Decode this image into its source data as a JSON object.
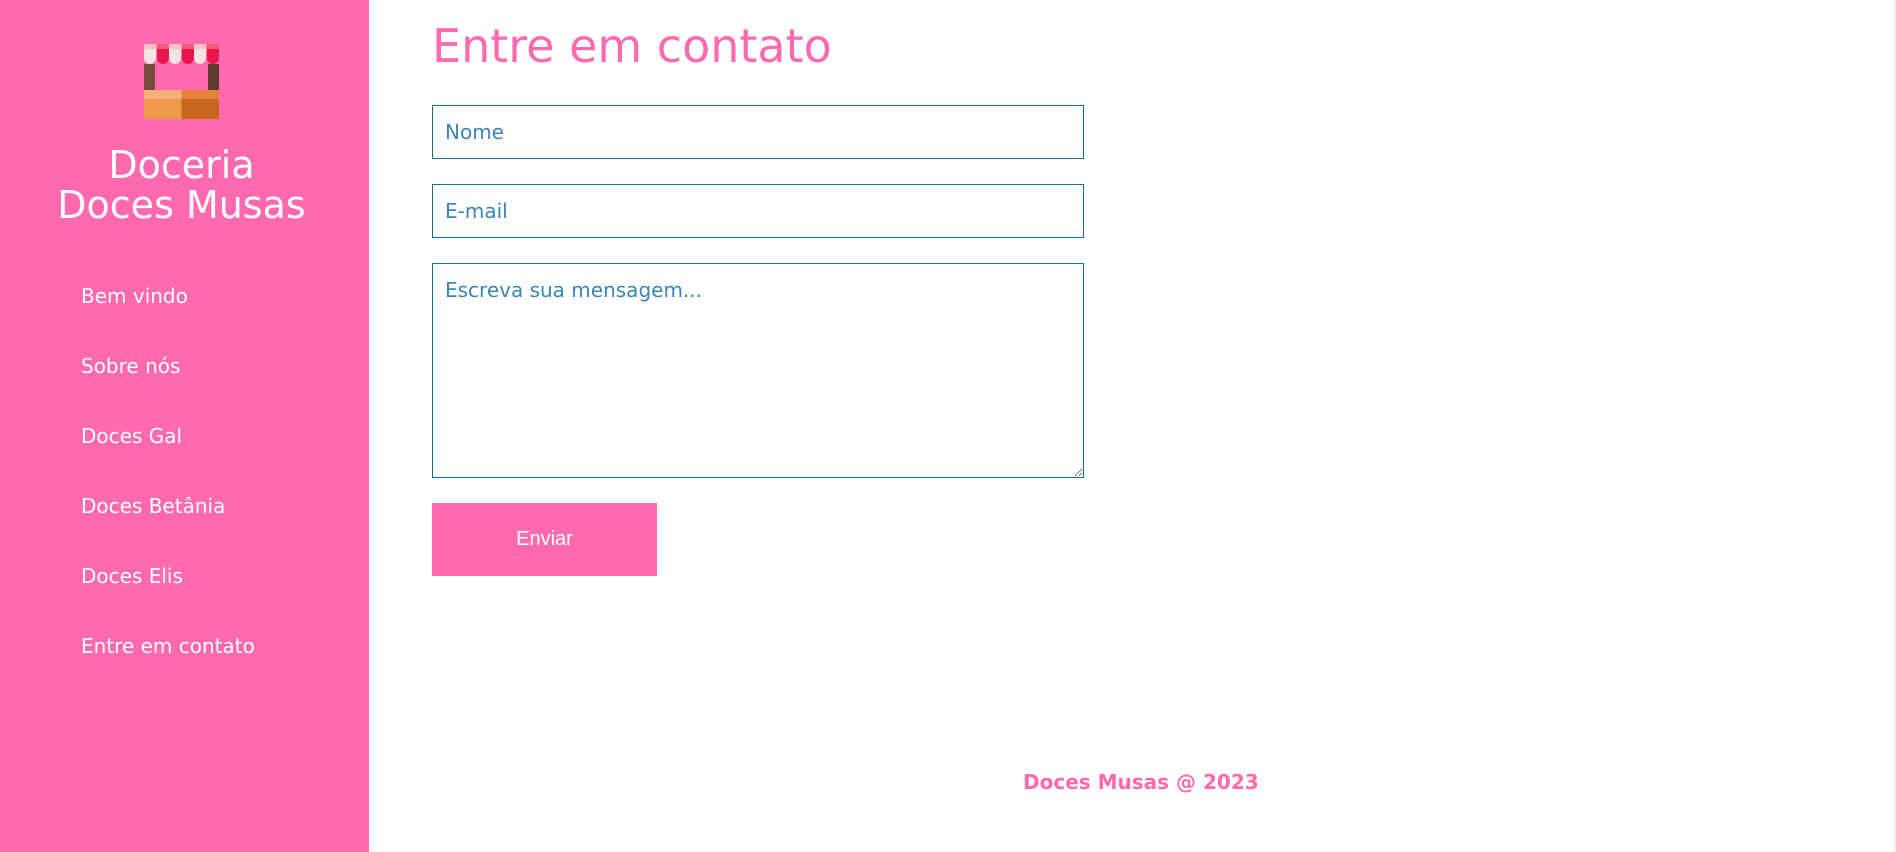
{
  "sidebar": {
    "logo_icon": "sweet-shop-stall-icon",
    "brand_line1": "Doceria",
    "brand_line2": "Doces Musas",
    "items": [
      {
        "label": "Bem vindo"
      },
      {
        "label": "Sobre nós"
      },
      {
        "label": "Doces Gal"
      },
      {
        "label": "Doces Betânia"
      },
      {
        "label": "Doces Elis"
      },
      {
        "label": "Entre em contato"
      }
    ]
  },
  "main": {
    "title": "Entre em contato",
    "form": {
      "name_placeholder": "Nome",
      "email_placeholder": "E-mail",
      "message_placeholder": "Escreva sua mensagem...",
      "submit_label": "Enviar"
    }
  },
  "footer": {
    "text": "Doces Musas @ 2023"
  },
  "colors": {
    "primary_pink": "#ff69b0",
    "field_border": "#1a6c9c",
    "field_text": "#3a86b8"
  }
}
